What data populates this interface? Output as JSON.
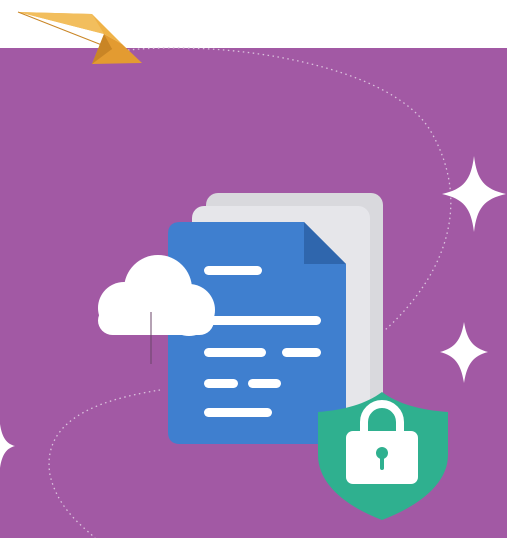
{
  "colors": {
    "background_top": "#ffffff",
    "panel_purple": "#a259a4",
    "document_blue": "#3f7fcf",
    "document_fold": "#2f66ad",
    "back_pages": "#e2e3e7",
    "cloud_white": "#ffffff",
    "shield_teal": "#2fb08f",
    "lock_white": "#ffffff",
    "paper_plane_orange": "#e9a33a",
    "sparkle_white": "#ffffff",
    "dotted_path": "#dbc3de"
  },
  "icons": {
    "paper_plane": "paper-plane-icon",
    "document": "document-icon",
    "cloud": "cloud-icon",
    "shield_lock": "shield-lock-icon",
    "sparkle": "sparkle-icon"
  }
}
